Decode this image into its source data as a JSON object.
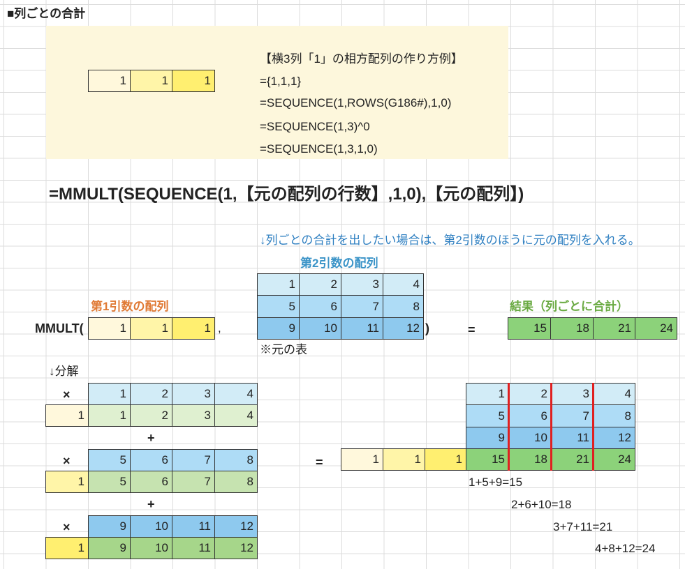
{
  "header": {
    "title": "■列ごとの合計"
  },
  "info_box": {
    "row": [
      "1",
      "1",
      "1"
    ],
    "lines": [
      "【横3列「1」の相方配列の作り方例】",
      "={1,1,1}",
      "=SEQUENCE(1,ROWS(G186#),1,0)",
      "=SEQUENCE(1,3)^0",
      "=SEQUENCE(1,3,1,0)"
    ]
  },
  "formula": "=MMULT(SEQUENCE(1,【元の配列の行数】,1,0),【元の配列】)",
  "note": "↓列ごとの合計を出したい場合は、第2引数のほうに元の配列を入れる。",
  "arg1_label": "第1引数の配列",
  "arg2_label": "第2引数の配列",
  "result_label": "結果（列ごとに合計）",
  "mmult_open": "MMULT(",
  "comma": ",",
  "close_paren": ")",
  "equals": "=",
  "arg1": [
    "1",
    "1",
    "1"
  ],
  "arg2": [
    [
      "1",
      "2",
      "3",
      "4"
    ],
    [
      "5",
      "6",
      "7",
      "8"
    ],
    [
      "9",
      "10",
      "11",
      "12"
    ]
  ],
  "table_note": "※元の表",
  "result": [
    "15",
    "18",
    "21",
    "24"
  ],
  "decompose": {
    "label": "↓分解",
    "times": "×",
    "plus": "+",
    "blocks": [
      {
        "top": [
          "1",
          "2",
          "3",
          "4"
        ],
        "factor": "1",
        "bottom": [
          "1",
          "2",
          "3",
          "4"
        ]
      },
      {
        "top": [
          "5",
          "6",
          "7",
          "8"
        ],
        "factor": "1",
        "bottom": [
          "5",
          "6",
          "7",
          "8"
        ]
      },
      {
        "top": [
          "9",
          "10",
          "11",
          "12"
        ],
        "factor": "1",
        "bottom": [
          "9",
          "10",
          "11",
          "12"
        ]
      }
    ]
  },
  "right": {
    "matrix": [
      [
        "1",
        "2",
        "3",
        "4"
      ],
      [
        "5",
        "6",
        "7",
        "8"
      ],
      [
        "9",
        "10",
        "11",
        "12"
      ]
    ],
    "ones": [
      "1",
      "1",
      "1"
    ],
    "result": [
      "15",
      "18",
      "21",
      "24"
    ],
    "sums": [
      "1+5+9=15",
      "2+6+10=18",
      "3+7+11=21",
      "4+8+12=24"
    ]
  }
}
